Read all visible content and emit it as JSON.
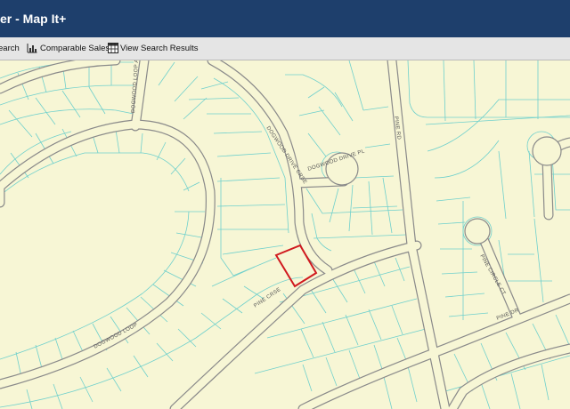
{
  "header": {
    "title": "er - Map It+"
  },
  "toolbar": {
    "search_label": "earch",
    "comparable_sales_label": "Comparable Sales",
    "view_search_results_label": "View Search Results"
  },
  "map": {
    "streets": {
      "dogwood_loop_ave": "DOGWOOD LOOP AVE",
      "dogwood_drive_crse": "DOGWOOD DRIVE CRSE",
      "dogwood_drive_pl": "DOGWOOD DRIVE PL",
      "pine_rd": "PINE RD",
      "pine_crse": "PINE CRSE",
      "dogwood_loop": "DOGWOOD LOOP",
      "pine_circle_ct": "PINE CIRCLE CT",
      "pine_dr": "PINE DR"
    },
    "colors": {
      "background": "#f7f6d5",
      "parcel_lines": "#6fd0cc",
      "road_edge": "#8a8a8a",
      "highlight": "#d0191e"
    }
  }
}
